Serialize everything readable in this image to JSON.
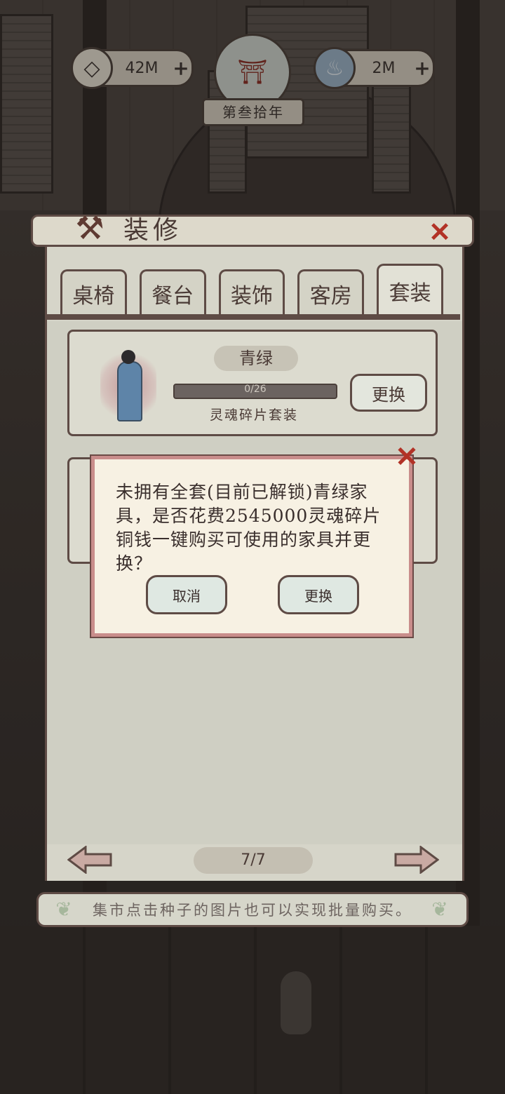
{
  "hud": {
    "coin_value": "42M",
    "soul_value": "2M",
    "plus": "+",
    "year": "第叁拾年"
  },
  "panel": {
    "title": "装修",
    "tabs": [
      {
        "label": "桌椅",
        "active": false
      },
      {
        "label": "餐台",
        "active": false
      },
      {
        "label": "装饰",
        "active": false
      },
      {
        "label": "客房",
        "active": false
      },
      {
        "label": "套装",
        "active": true
      }
    ],
    "card": {
      "name": "青绿",
      "progress": "0/26",
      "progress_fraction": 0,
      "subtitle": "灵魂碎片套装",
      "button": "更换"
    },
    "page": "7/7"
  },
  "tip": "集市点击种子的图片也可以实现批量购买。",
  "modal": {
    "message": "未拥有全套(目前已解锁)青绿家具，是否花费2545000灵魂碎片铜钱一键购买可使用的家具并更换？",
    "cancel": "取消",
    "confirm": "更换"
  },
  "colors": {
    "accent_red": "#b23226",
    "frame": "#5e4b45",
    "paper": "#f7f1e3"
  }
}
